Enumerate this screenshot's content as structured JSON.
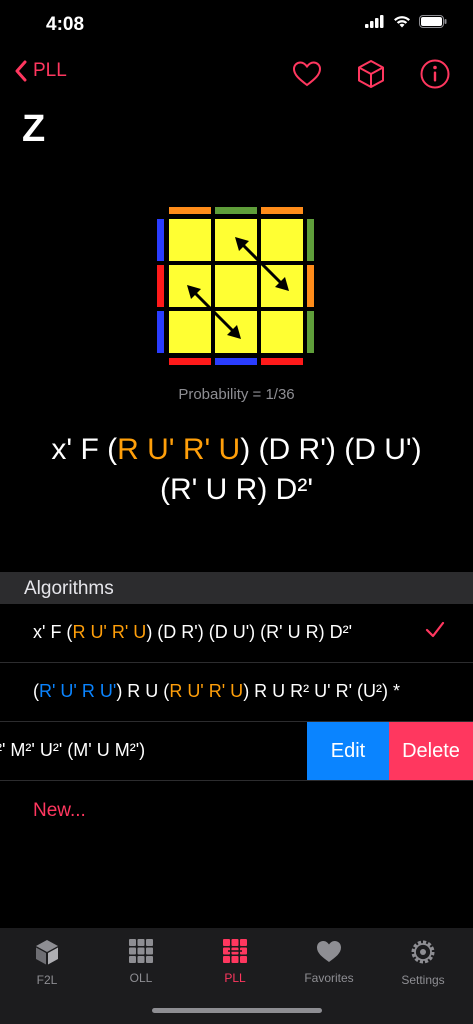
{
  "status": {
    "time": "4:08"
  },
  "nav": {
    "back_label": "PLL"
  },
  "title": "Z",
  "probability": "Probability = 1/36",
  "main_alg": {
    "line1": [
      {
        "t": "x' F (",
        "c": "white"
      },
      {
        "t": "R U' R' U",
        "c": "orange"
      },
      {
        "t": ") (D R') (D U')",
        "c": "white"
      }
    ],
    "line2": "(R' U R) D²'"
  },
  "section_header": "Algorithms",
  "algorithms": [
    {
      "parts": [
        {
          "t": "x' F (",
          "c": "white"
        },
        {
          "t": "R U' R' U",
          "c": "orange"
        },
        {
          "t": ") (D R') (D U') (R' U R) D²'",
          "c": "white"
        }
      ],
      "selected": true
    },
    {
      "parts": [
        {
          "t": "(",
          "c": "white"
        },
        {
          "t": "R' U' R U'",
          "c": "blue"
        },
        {
          "t": ") R U (",
          "c": "white"
        },
        {
          "t": "R U' R' U",
          "c": "orange"
        },
        {
          "t": ") R U R² U' R' (U²) *",
          "c": "white"
        }
      ],
      "selected": false
    },
    {
      "parts": [
        {
          "t": "²' M²' U²' (M' U M²')",
          "c": "white"
        }
      ],
      "selected": false
    }
  ],
  "swipe": {
    "edit": "Edit",
    "delete": "Delete"
  },
  "new_label": "New...",
  "tabs": [
    {
      "label": "F2L",
      "icon": "cube-icon"
    },
    {
      "label": "OLL",
      "icon": "grid-icon"
    },
    {
      "label": "PLL",
      "icon": "pll-icon",
      "active": true
    },
    {
      "label": "Favorites",
      "icon": "heart-icon"
    },
    {
      "label": "Settings",
      "icon": "gear-icon"
    }
  ],
  "colors": {
    "accent": "#ff375f",
    "orange": "#ff9f0a",
    "blue": "#0a84ff",
    "yellow": "#ffff33",
    "red": "#ff1a1a",
    "green": "#5f9e3a",
    "cube_blue": "#2a3dff",
    "cube_orange": "#ff8c1a"
  }
}
